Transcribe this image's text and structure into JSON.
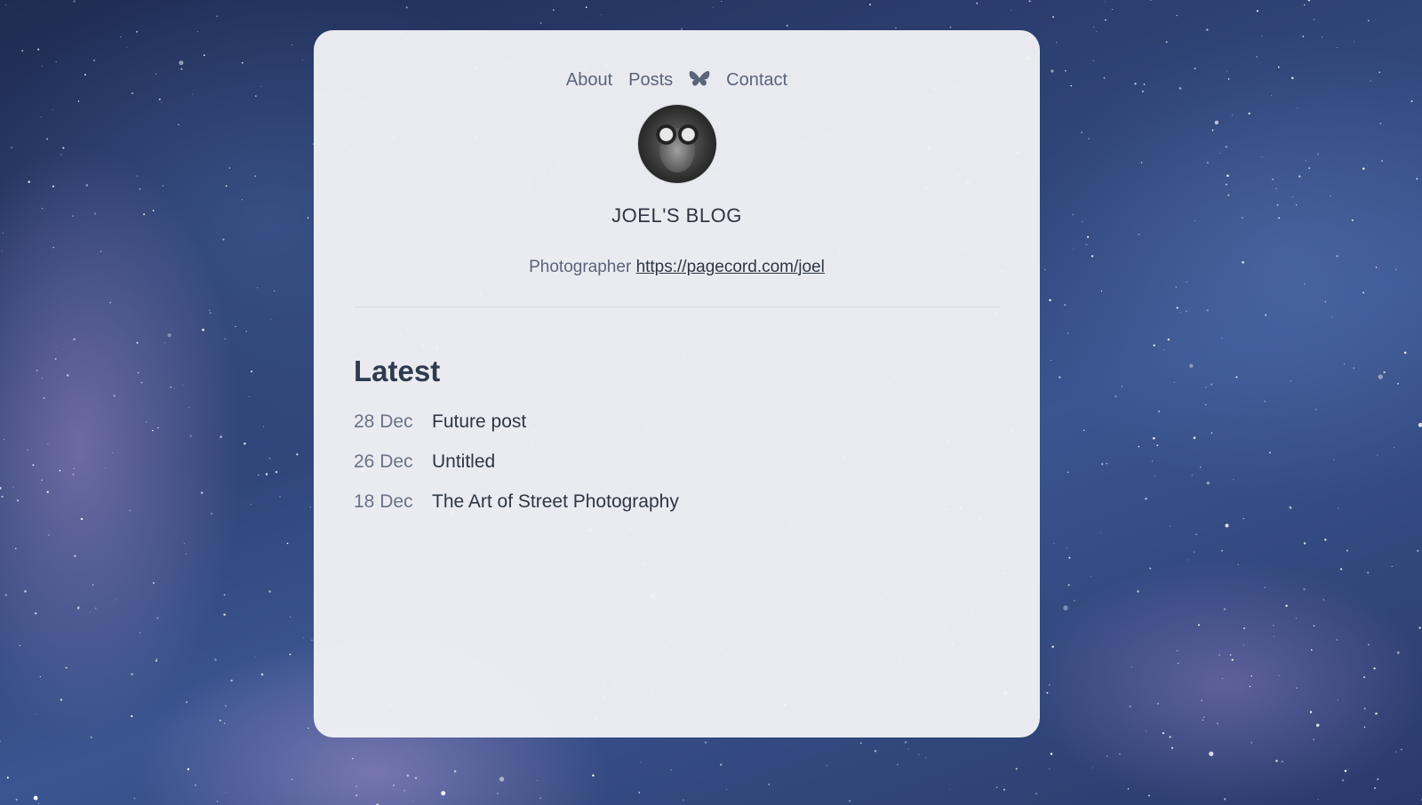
{
  "nav": {
    "about_label": "About",
    "posts_label": "Posts",
    "bluesky_icon": "butterfly-icon",
    "contact_label": "Contact"
  },
  "header": {
    "site_title": "JOEL'S BLOG",
    "bio_text": "Photographer",
    "bio_link": "https://pagecord.com/joel"
  },
  "latest": {
    "heading": "Latest",
    "posts": [
      {
        "date": "28 Dec",
        "title": "Future post"
      },
      {
        "date": "26 Dec",
        "title": "Untitled"
      },
      {
        "date": "18 Dec",
        "title": "The Art of Street Photography"
      }
    ]
  },
  "colors": {
    "accent_text": "#2f3542",
    "muted_text": "#5b6478",
    "card_background": "#f1f2f6",
    "page_background": "#2b3a62"
  }
}
